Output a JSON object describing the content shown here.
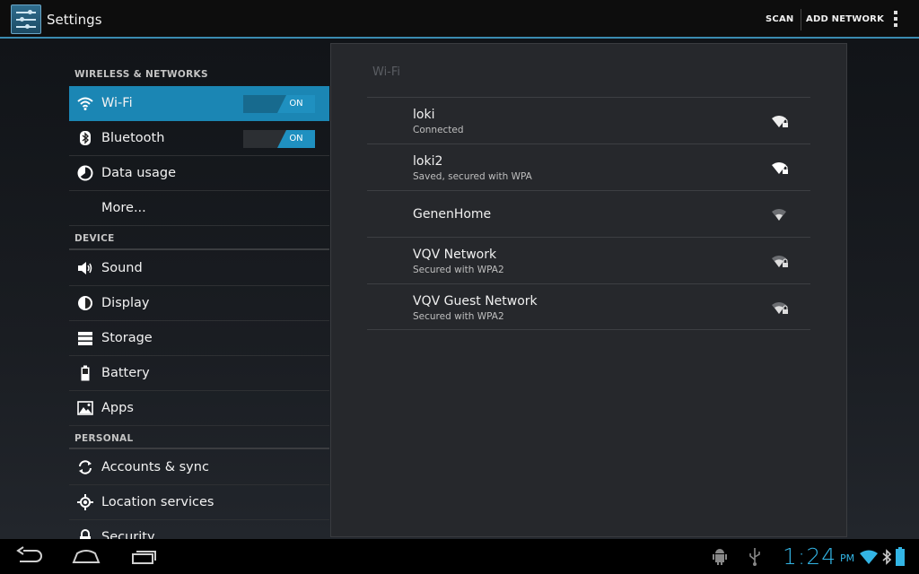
{
  "actionbar": {
    "title": "Settings",
    "scan_label": "SCAN",
    "add_network_label": "ADD NETWORK"
  },
  "sidebar": {
    "sections": {
      "wireless": "WIRELESS & NETWORKS",
      "device": "DEVICE",
      "personal": "PERSONAL"
    },
    "items": [
      {
        "label": "Wi-Fi",
        "icon": "wifi-icon",
        "toggle": "ON",
        "selected": true
      },
      {
        "label": "Bluetooth",
        "icon": "bluetooth-icon",
        "toggle": "ON"
      },
      {
        "label": "Data usage",
        "icon": "data-usage-icon"
      },
      {
        "label": "More...",
        "icon": ""
      },
      {
        "label": "Sound",
        "icon": "sound-icon"
      },
      {
        "label": "Display",
        "icon": "display-icon"
      },
      {
        "label": "Storage",
        "icon": "storage-icon"
      },
      {
        "label": "Battery",
        "icon": "battery-icon"
      },
      {
        "label": "Apps",
        "icon": "apps-icon"
      },
      {
        "label": "Accounts & sync",
        "icon": "sync-icon"
      },
      {
        "label": "Location services",
        "icon": "location-icon"
      },
      {
        "label": "Security",
        "icon": "lock-icon"
      }
    ]
  },
  "wifi_panel": {
    "title": "Wi-Fi",
    "networks": [
      {
        "name": "loki",
        "status": "Connected",
        "secured": true
      },
      {
        "name": "loki2",
        "status": "Saved, secured with WPA",
        "secured": true
      },
      {
        "name": "GenenHome",
        "status": "",
        "secured": false
      },
      {
        "name": "VQV Network",
        "status": "Secured with WPA2",
        "secured": true
      },
      {
        "name": "VQV Guest Network",
        "status": "Secured with WPA2",
        "secured": true
      }
    ]
  },
  "statusbar": {
    "time": "1:24",
    "ampm": "PM"
  },
  "colors": {
    "accent": "#33b5e5",
    "selected": "#1b86b4"
  }
}
